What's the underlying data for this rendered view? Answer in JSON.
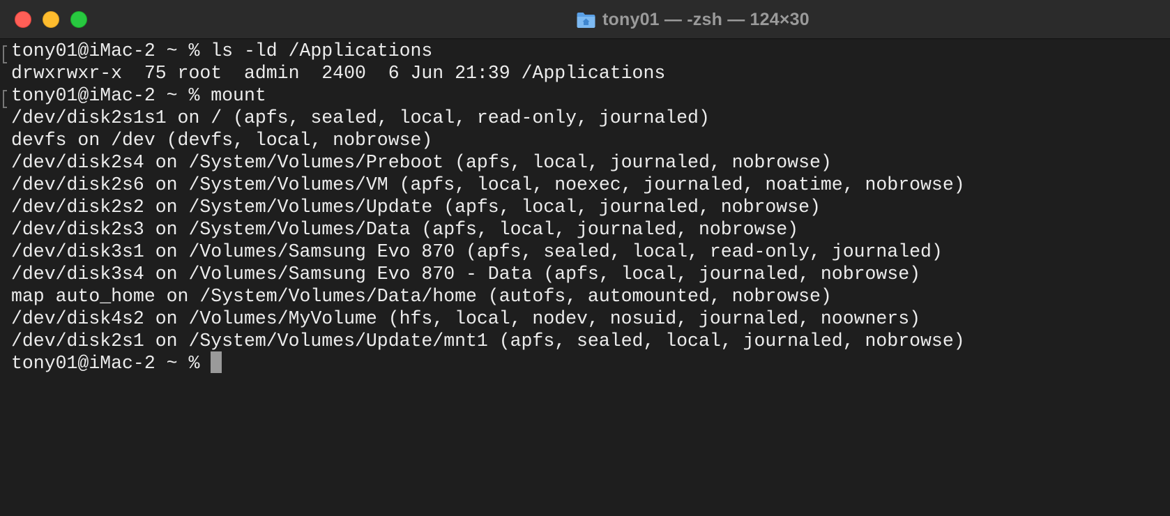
{
  "window": {
    "title": "tony01 — -zsh — 124×30",
    "title_icon": "home-folder-icon"
  },
  "colors": {
    "background": "#1e1e1e",
    "titlebar": "#2b2b2b",
    "text": "#ececec",
    "close": "#ff5f57",
    "minimize": "#febc2e",
    "maximize": "#28c840",
    "cursor": "#9a9a9a"
  },
  "terminal": {
    "lines": [
      "tony01@iMac-2 ~ % ls -ld /Applications",
      "drwxrwxr-x  75 root  admin  2400  6 Jun 21:39 /Applications",
      "tony01@iMac-2 ~ % mount",
      "/dev/disk2s1s1 on / (apfs, sealed, local, read-only, journaled)",
      "devfs on /dev (devfs, local, nobrowse)",
      "/dev/disk2s4 on /System/Volumes/Preboot (apfs, local, journaled, nobrowse)",
      "/dev/disk2s6 on /System/Volumes/VM (apfs, local, noexec, journaled, noatime, nobrowse)",
      "/dev/disk2s2 on /System/Volumes/Update (apfs, local, journaled, nobrowse)",
      "/dev/disk2s3 on /System/Volumes/Data (apfs, local, journaled, nobrowse)",
      "/dev/disk3s1 on /Volumes/Samsung Evo 870 (apfs, sealed, local, read-only, journaled)",
      "/dev/disk3s4 on /Volumes/Samsung Evo 870 - Data (apfs, local, journaled, nobrowse)",
      "map auto_home on /System/Volumes/Data/home (autofs, automounted, nobrowse)",
      "/dev/disk4s2 on /Volumes/MyVolume (hfs, local, nodev, nosuid, journaled, noowners)",
      "/dev/disk2s1 on /System/Volumes/Update/mnt1 (apfs, sealed, local, journaled, nobrowse)"
    ],
    "current_prompt": "tony01@iMac-2 ~ % "
  }
}
